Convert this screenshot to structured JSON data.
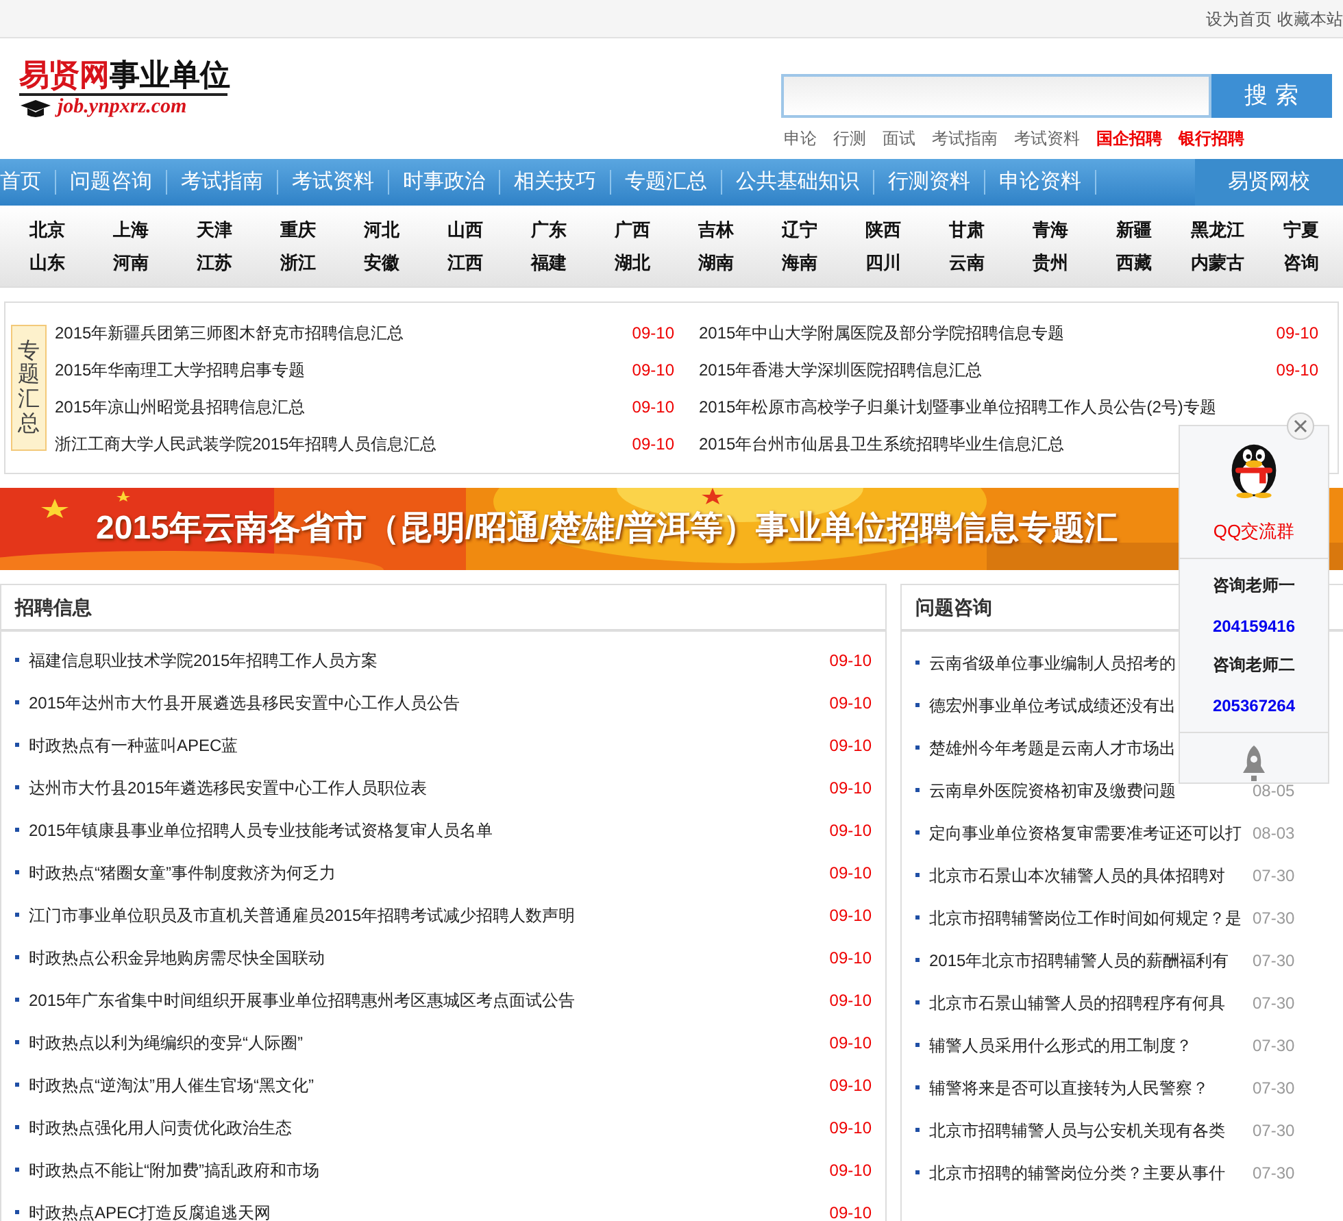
{
  "top_links": [
    "设为首页",
    "收藏本站"
  ],
  "logo": {
    "name_red": "易贤网",
    "name_black": "事业单位",
    "domain": "job.ynpxrz.com"
  },
  "search": {
    "button": "搜 索"
  },
  "hot_links": [
    {
      "label": "申论",
      "highlight": false
    },
    {
      "label": "行测",
      "highlight": false
    },
    {
      "label": "面试",
      "highlight": false
    },
    {
      "label": "考试指南",
      "highlight": false
    },
    {
      "label": "考试资料",
      "highlight": false
    },
    {
      "label": "国企招聘",
      "highlight": true
    },
    {
      "label": "银行招聘",
      "highlight": true
    }
  ],
  "nav": [
    "首页",
    "问题咨询",
    "考试指南",
    "考试资料",
    "时事政治",
    "相关技巧",
    "专题汇总",
    "公共基础知识",
    "行测资料",
    "申论资料"
  ],
  "nav_right": "易贤网校",
  "provinces": [
    [
      "北京",
      "上海",
      "天津",
      "重庆",
      "河北",
      "山西",
      "广东",
      "广西",
      "吉林",
      "辽宁",
      "陕西",
      "甘肃",
      "青海",
      "新疆",
      "黑龙江",
      "宁夏"
    ],
    [
      "山东",
      "河南",
      "江苏",
      "浙江",
      "安徽",
      "江西",
      "福建",
      "湖北",
      "湖南",
      "海南",
      "四川",
      "云南",
      "贵州",
      "西藏",
      "内蒙古",
      "咨询"
    ]
  ],
  "topics": {
    "label": "专题汇总",
    "items": [
      {
        "title": "2015年新疆兵团第三师图木舒克市招聘信息汇总",
        "date": "09-10"
      },
      {
        "title": "2015年中山大学附属医院及部分学院招聘信息专题",
        "date": "09-10"
      },
      {
        "title": "2015年华南理工大学招聘启事专题",
        "date": "09-10"
      },
      {
        "title": "2015年香港大学深圳医院招聘信息汇总",
        "date": "09-10"
      },
      {
        "title": "2015年凉山州昭觉县招聘信息汇总",
        "date": "09-10"
      },
      {
        "title": "2015年松原市高校学子归巢计划暨事业单位招聘工作人员公告(2号)专题"
      },
      {
        "title": "浙江工商大学人民武装学院2015年招聘人员信息汇总",
        "date": "09-10"
      },
      {
        "title": "2015年台州市仙居县卫生系统招聘毕业生信息汇总"
      }
    ]
  },
  "banner": {
    "text": "2015年云南各省市（昆明/昭通/楚雄/普洱等）事业单位招聘信息专题汇"
  },
  "jobs": {
    "title": "招聘信息",
    "items": [
      {
        "title": "福建信息职业技术学院2015年招聘工作人员方案",
        "date": "09-10"
      },
      {
        "title": "2015年达州市大竹县开展遴选县移民安置中心工作人员公告",
        "date": "09-10"
      },
      {
        "title": "时政热点有一种蓝叫APEC蓝",
        "date": "09-10"
      },
      {
        "title": "达州市大竹县2015年遴选移民安置中心工作人员职位表",
        "date": "09-10"
      },
      {
        "title": "2015年镇康县事业单位招聘人员专业技能考试资格复审人员名单",
        "date": "09-10"
      },
      {
        "title": "时政热点“猪圈女童”事件制度救济为何乏力",
        "date": "09-10"
      },
      {
        "title": "江门市事业单位职员及市直机关普通雇员2015年招聘考试减少招聘人数声明",
        "date": "09-10"
      },
      {
        "title": "时政热点公积金异地购房需尽快全国联动",
        "date": "09-10"
      },
      {
        "title": "2015年广东省集中时间组织开展事业单位招聘惠州考区惠城区考点面试公告",
        "date": "09-10"
      },
      {
        "title": "时政热点以利为绳编织的变异“人际圈”",
        "date": "09-10"
      },
      {
        "title": "时政热点“逆淘汰”用人催生官场“黑文化”",
        "date": "09-10"
      },
      {
        "title": "时政热点强化用人问责优化政治生态",
        "date": "09-10"
      },
      {
        "title": "时政热点不能让“附加费”搞乱政府和市场",
        "date": "09-10"
      },
      {
        "title": "时政热点APEC打造反腐追逃天网",
        "date": "09-10"
      }
    ]
  },
  "questions": {
    "title": "问题咨询",
    "items": [
      {
        "title": "云南省级单位事业编制人员招考的"
      },
      {
        "title": "德宏州事业单位考试成绩还没有出"
      },
      {
        "title": "楚雄州今年考题是云南人才市场出"
      },
      {
        "title": "云南阜外医院资格初审及缴费问题",
        "date": "08-05"
      },
      {
        "title": "定向事业单位资格复审需要准考证还可以打",
        "date": "08-03"
      },
      {
        "title": "北京市石景山本次辅警人员的具体招聘对",
        "date": "07-30"
      },
      {
        "title": "北京市招聘辅警岗位工作时间如何规定？是",
        "date": "07-30"
      },
      {
        "title": "2015年北京市招聘辅警人员的薪酬福利有",
        "date": "07-30"
      },
      {
        "title": "北京市石景山辅警人员的招聘程序有何具",
        "date": "07-30"
      },
      {
        "title": "辅警人员采用什么形式的用工制度？",
        "date": "07-30"
      },
      {
        "title": "辅警将来是否可以直接转为人民警察？",
        "date": "07-30"
      },
      {
        "title": "北京市招聘辅警人员与公安机关现有各类",
        "date": "07-30"
      },
      {
        "title": "北京市招聘的辅警岗位分类？主要从事什",
        "date": "07-30"
      }
    ]
  },
  "qq_widget": {
    "group": "QQ交流群",
    "contacts": [
      {
        "label": "咨询老师一",
        "number": "204159416"
      },
      {
        "label": "咨询老师二",
        "number": "205367264"
      }
    ]
  }
}
